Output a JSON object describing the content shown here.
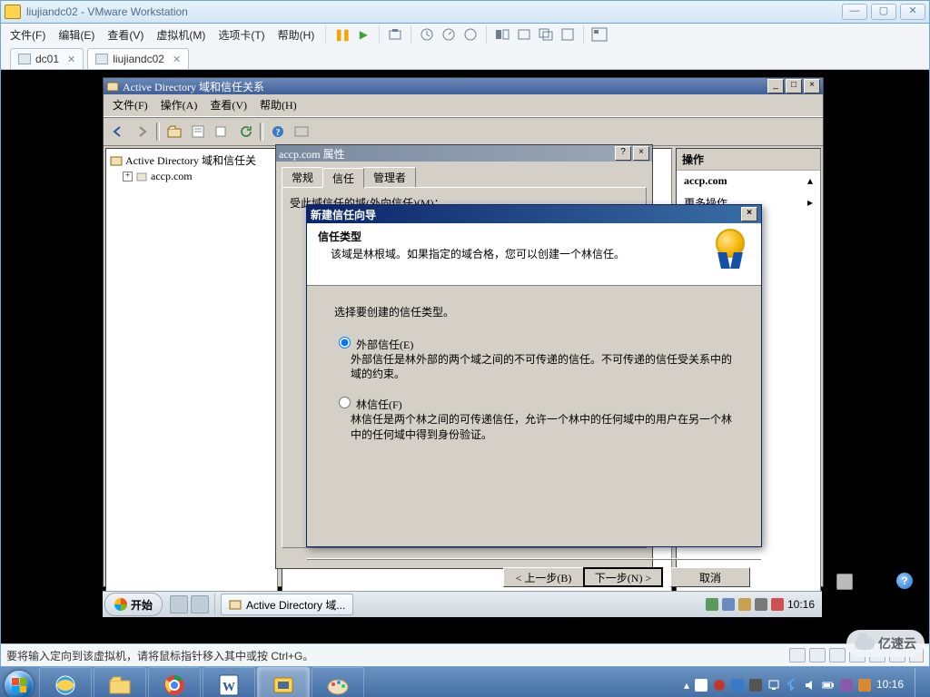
{
  "outer": {
    "title": "liujiandc02 - VMware Workstation",
    "menus": [
      "文件(F)",
      "编辑(E)",
      "查看(V)",
      "虚拟机(M)",
      "选项卡(T)",
      "帮助(H)"
    ]
  },
  "vm_tabs": [
    {
      "label": "dc01",
      "active": false
    },
    {
      "label": "liujiandc02",
      "active": true
    }
  ],
  "status_hint": "要将输入定向到该虚拟机，请将鼠标指针移入其中或按 Ctrl+G。",
  "mmc": {
    "title": "Active Directory 域和信任关系",
    "menus": [
      "文件(F)",
      "操作(A)",
      "查看(V)",
      "帮助(H)"
    ],
    "tree_root": "Active Directory 域和信任关",
    "tree_child": "accp.com",
    "actions_header": "操作",
    "actions_domain": "accp.com",
    "actions_more": "更多操作"
  },
  "props": {
    "title": "accp.com 属性",
    "tabs": [
      "常规",
      "信任",
      "管理者"
    ],
    "active_tab": 1,
    "body_hint": "受此域信任的域(外向信任)(M)："
  },
  "wizard": {
    "title": "新建信任向导",
    "heading": "信任类型",
    "subheading": "该域是林根域。如果指定的域合格，您可以创建一个林信任。",
    "intro": "选择要创建的信任类型。",
    "options": [
      {
        "label": "外部信任(E)",
        "desc": "外部信任是林外部的两个域之间的不可传递的信任。不可传递的信任受关系中的域的约束。",
        "checked": true
      },
      {
        "label": "林信任(F)",
        "desc": "林信任是两个林之间的可传递信任，允许一个林中的任何域中的用户在另一个林中的任何域中得到身份验证。",
        "checked": false
      }
    ],
    "buttons": {
      "back": "< 上一步(B)",
      "next": "下一步(N) >",
      "cancel": "取消"
    }
  },
  "guest_taskbar": {
    "start": "开始",
    "task_app": "Active Directory 域...",
    "clock": "10:16"
  },
  "host": {
    "clock_time": "10:16",
    "clock_date": "",
    "watermark": "亿速云"
  }
}
